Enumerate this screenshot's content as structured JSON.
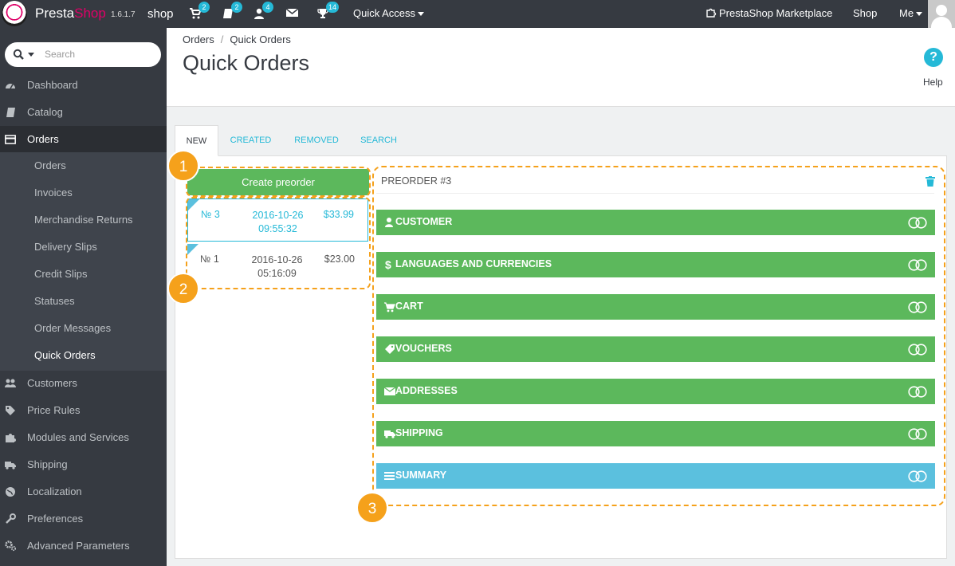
{
  "topbar": {
    "brand_a": "Presta",
    "brand_b": "Shop",
    "version": "1.6.1.7",
    "shop_name": "shop",
    "badges": {
      "cart": "2",
      "orders": "2",
      "customers": "4",
      "trophy": "14"
    },
    "quick_access": "Quick Access",
    "marketplace": "PrestaShop Marketplace",
    "shop_link": "Shop",
    "me": "Me"
  },
  "sidebar": {
    "search_placeholder": "Search",
    "items": [
      {
        "label": "Dashboard",
        "icon": "dashboard-icon"
      },
      {
        "label": "Catalog",
        "icon": "book-icon"
      },
      {
        "label": "Orders",
        "icon": "credit-card-icon"
      },
      {
        "label": "Customers",
        "icon": "users-icon"
      },
      {
        "label": "Price Rules",
        "icon": "tags-icon"
      },
      {
        "label": "Modules and Services",
        "icon": "puzzle-icon"
      },
      {
        "label": "Shipping",
        "icon": "truck-icon"
      },
      {
        "label": "Localization",
        "icon": "globe-icon"
      },
      {
        "label": "Preferences",
        "icon": "wrench-icon"
      },
      {
        "label": "Advanced Parameters",
        "icon": "cogs-icon"
      }
    ],
    "orders_sub": [
      "Orders",
      "Invoices",
      "Merchandise Returns",
      "Delivery Slips",
      "Credit Slips",
      "Statuses",
      "Order Messages",
      "Quick Orders"
    ]
  },
  "header": {
    "breadcrumb_parent": "Orders",
    "breadcrumb_sep": "/",
    "breadcrumb_current": "Quick Orders",
    "title": "Quick Orders",
    "help_label": "Help"
  },
  "tabs": [
    "NEW",
    "CREATED",
    "REMOVED",
    "SEARCH"
  ],
  "left": {
    "create_label": "Create preorder",
    "orders": [
      {
        "num": "№ 3",
        "date": "2016-10-26",
        "time": "09:55:32",
        "amount": "$33.99"
      },
      {
        "num": "№ 1",
        "date": "2016-10-26",
        "time": "05:16:09",
        "amount": "$23.00"
      }
    ]
  },
  "right": {
    "title": "PREORDER #3",
    "sections": [
      {
        "label": "CUSTOMER",
        "icon": "user-icon"
      },
      {
        "label": "LANGUAGES AND CURRENCIES",
        "icon": "dollar-icon"
      },
      {
        "label": "CART",
        "icon": "cart-icon"
      },
      {
        "label": "VOUCHERS",
        "icon": "tag-icon"
      },
      {
        "label": "ADDRESSES",
        "icon": "envelope-icon"
      },
      {
        "label": "SHIPPING",
        "icon": "truck-icon"
      },
      {
        "label": "SUMMARY",
        "icon": "list-icon"
      }
    ]
  },
  "markers": [
    "1",
    "2",
    "3"
  ],
  "colors": {
    "green": "#5cb85c",
    "blue": "#5bc0de",
    "accent": "#25b9d7",
    "annotation": "#f5a11b",
    "sidebar": "#363a41"
  }
}
